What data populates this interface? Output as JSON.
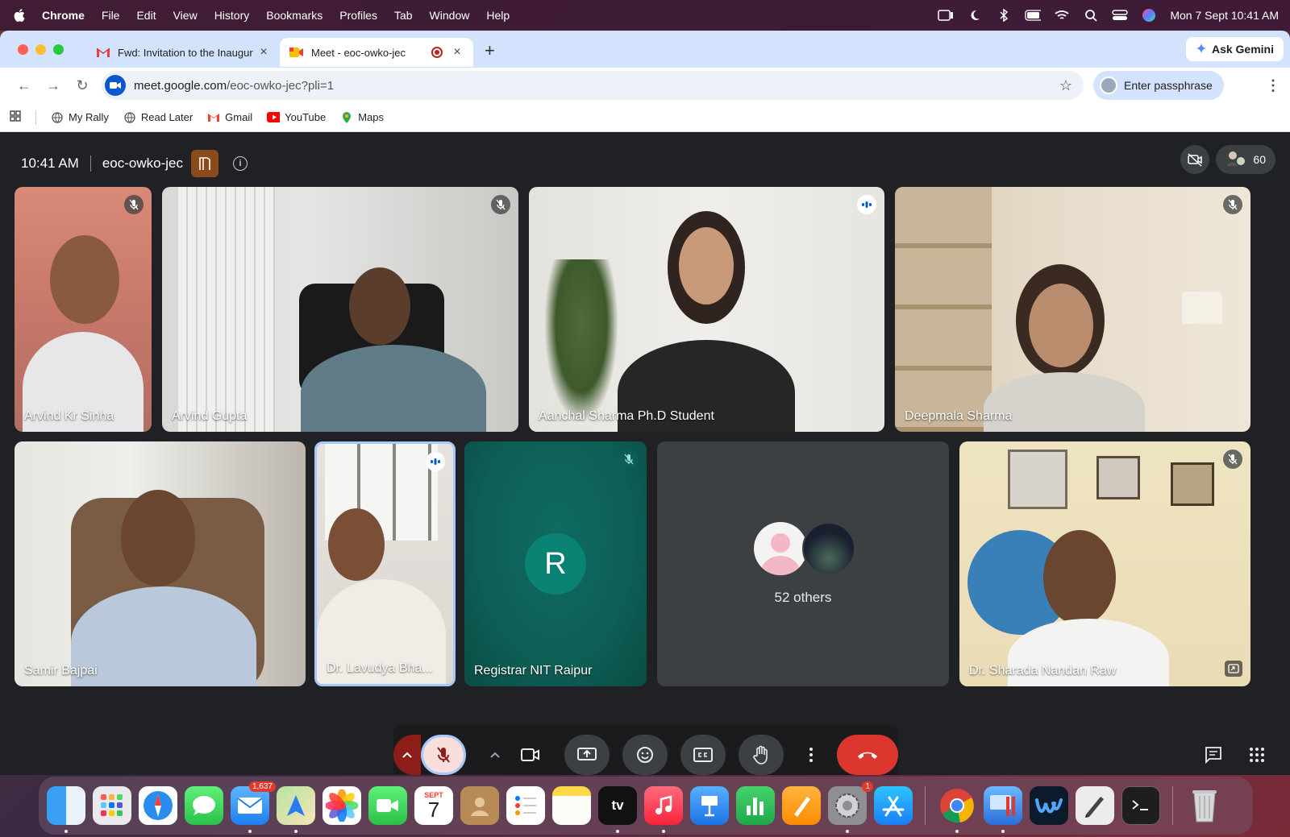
{
  "menubar": {
    "app": "Chrome",
    "items": [
      "File",
      "Edit",
      "View",
      "History",
      "Bookmarks",
      "Profiles",
      "Tab",
      "Window",
      "Help"
    ],
    "datetime": "Mon 7 Sept  10:41 AM"
  },
  "browser": {
    "tabs": [
      {
        "title": "Fwd: Invitation to the Inaugur",
        "icon": "gmail-icon"
      },
      {
        "title": "Meet - eoc-owko-jec",
        "icon": "meet-icon",
        "recording": true
      }
    ],
    "ask_gemini": "Ask Gemini",
    "url_host": "meet.google.com",
    "url_path": "/eoc-owko-jec?pli=1",
    "passphrase_button": "Enter passphrase",
    "bookmarks": [
      {
        "label": "My Rally",
        "icon": "globe-icon"
      },
      {
        "label": "Read Later",
        "icon": "globe-icon"
      },
      {
        "label": "Gmail",
        "icon": "gmail-icon"
      },
      {
        "label": "YouTube",
        "icon": "youtube-icon"
      },
      {
        "label": "Maps",
        "icon": "maps-icon"
      }
    ]
  },
  "meet": {
    "time": "10:41 AM",
    "meeting_code": "eoc-owko-jec",
    "participant_count": "60",
    "tiles": [
      {
        "name": "Arvind Kr Sinha",
        "status": "muted"
      },
      {
        "name": "Arvind Gupta",
        "status": "muted"
      },
      {
        "name": "Aanchal Sharma Ph.D Student",
        "status": "speaking"
      },
      {
        "name": "Deepmala Sharma",
        "status": "muted"
      },
      {
        "name": "Samir Bajpai",
        "status": ""
      },
      {
        "name": "Dr. Lavudya Bha...",
        "status": "speaking"
      },
      {
        "name": "Registrar NIT Raipur",
        "status": "muted",
        "initial": "R"
      },
      {
        "name": "52 others",
        "status": ""
      },
      {
        "name": "Dr. Sharada Nandan Raw",
        "status": "muted"
      }
    ]
  },
  "dock": {
    "mail_badge": "1,637",
    "calendar_month": "SEPT",
    "calendar_day": "7",
    "settings_badge": "1",
    "tv_label": "tv"
  },
  "colors": {
    "meet_bg": "#202124",
    "end_call": "#dc362e",
    "tab_strip": "#d3e3fd",
    "registrar_tile": "#0d5e55"
  }
}
